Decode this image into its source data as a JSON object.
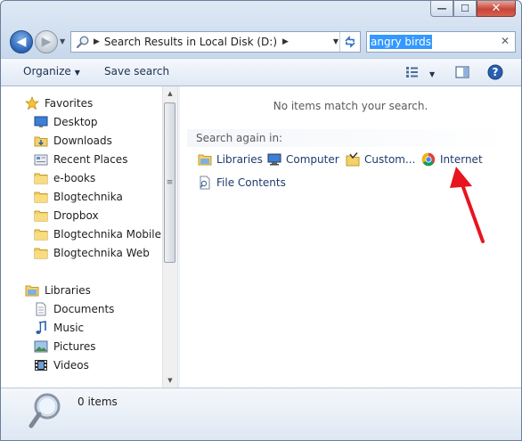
{
  "window": {
    "caption_buttons": [
      {
        "name": "minimize-button",
        "glyph": "—"
      },
      {
        "name": "maximize-button",
        "glyph": "☐"
      },
      {
        "name": "close-button",
        "glyph": "✕"
      }
    ]
  },
  "address": {
    "breadcrumb": "Search Results in Local Disk (D:)",
    "icons": {
      "back": "back-arrow-icon",
      "forward": "forward-arrow-icon",
      "location": "search-folder-icon",
      "refresh": "refresh-icon"
    }
  },
  "search": {
    "query": "angry birds",
    "clear_glyph": "✕"
  },
  "toolbar": {
    "organize_label": "Organize",
    "save_search_label": "Save search",
    "icons": [
      "change-view-icon",
      "preview-pane-icon",
      "help-icon"
    ]
  },
  "nav": {
    "favorites_label": "Favorites",
    "favorites": [
      {
        "label": "Desktop",
        "icon": "desktop-icon"
      },
      {
        "label": "Downloads",
        "icon": "downloads-folder-icon"
      },
      {
        "label": "Recent Places",
        "icon": "recent-places-icon"
      },
      {
        "label": "e-books",
        "icon": "folder-icon"
      },
      {
        "label": "Blogtechnika",
        "icon": "folder-icon"
      },
      {
        "label": "Dropbox",
        "icon": "folder-icon"
      },
      {
        "label": "Blogtechnika Mobile",
        "icon": "folder-icon"
      },
      {
        "label": "Blogtechnika Web",
        "icon": "folder-icon"
      }
    ],
    "libraries_label": "Libraries",
    "libraries": [
      {
        "label": "Documents",
        "icon": "documents-icon"
      },
      {
        "label": "Music",
        "icon": "music-icon"
      },
      {
        "label": "Pictures",
        "icon": "pictures-icon"
      },
      {
        "label": "Videos",
        "icon": "videos-icon"
      }
    ]
  },
  "results": {
    "empty_message": "No items match your search.",
    "search_again_label": "Search again in:",
    "options": [
      {
        "label": "Libraries",
        "icon": "libraries-icon"
      },
      {
        "label": "Computer",
        "icon": "computer-icon"
      },
      {
        "label": "Custom...",
        "icon": "custom-folder-icon"
      },
      {
        "label": "Internet",
        "icon": "chrome-icon"
      },
      {
        "label": "File Contents",
        "icon": "file-contents-icon"
      }
    ],
    "annotation_color": "#e8141e"
  },
  "details": {
    "count": "0 items",
    "icon": "magnifier-icon"
  }
}
